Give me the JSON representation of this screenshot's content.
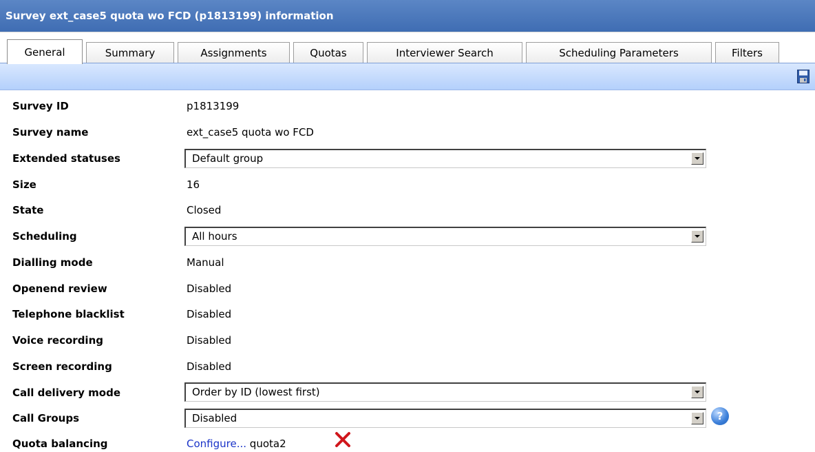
{
  "window": {
    "title": "Survey ext_case5 quota wo FCD (p1813199) information"
  },
  "tabs": [
    {
      "label": "General",
      "active": true
    },
    {
      "label": "Summary"
    },
    {
      "label": "Assignments"
    },
    {
      "label": "Quotas"
    },
    {
      "label": "Interviewer Search"
    },
    {
      "label": "Scheduling Parameters"
    },
    {
      "label": "Filters"
    }
  ],
  "toolbar": {
    "save_icon": "save-icon"
  },
  "fields": {
    "survey_id": {
      "label": "Survey ID",
      "value": "p1813199"
    },
    "survey_name": {
      "label": "Survey name",
      "value": "ext_case5 quota wo FCD"
    },
    "extended_statuses": {
      "label": "Extended statuses",
      "selected": "Default group"
    },
    "size": {
      "label": "Size",
      "value": "16"
    },
    "state": {
      "label": "State",
      "value": "Closed"
    },
    "scheduling": {
      "label": "Scheduling",
      "selected": "All hours"
    },
    "dialling_mode": {
      "label": "Dialling mode",
      "value": "Manual"
    },
    "openend_review": {
      "label": "Openend review",
      "value": "Disabled"
    },
    "telephone_blacklist": {
      "label": "Telephone blacklist",
      "value": "Disabled"
    },
    "voice_recording": {
      "label": "Voice recording",
      "value": "Disabled"
    },
    "screen_recording": {
      "label": "Screen recording",
      "value": "Disabled"
    },
    "call_delivery_mode": {
      "label": "Call delivery mode",
      "selected": "Order by ID (lowest first)"
    },
    "call_groups": {
      "label": "Call Groups",
      "selected": "Disabled",
      "help_glyph": "?"
    },
    "quota_balancing": {
      "label": "Quota balancing",
      "link": "Configure...",
      "value": "quota2"
    }
  },
  "colors": {
    "title_bar": "#4a78bd",
    "toolbar": "#c2d9fc",
    "link": "#1a33c8",
    "delete": "#d0161c"
  }
}
